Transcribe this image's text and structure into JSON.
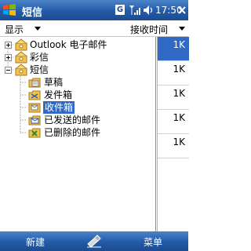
{
  "titlebar": {
    "title": "短信",
    "g_badge": "G",
    "time": "17:50",
    "icons": [
      "windows-start-icon",
      "signal-icon",
      "volume-icon",
      "close-icon"
    ]
  },
  "menubar": {
    "show_label": "显示",
    "sort_label": "接收时间"
  },
  "tree": {
    "items": [
      {
        "label": "Outlook 电子邮件",
        "icon": "account-icon",
        "expander": "plus"
      },
      {
        "label": "彩信",
        "icon": "account-icon",
        "expander": "plus"
      },
      {
        "label": "短信",
        "icon": "account-icon",
        "expander": "minus"
      },
      {
        "label": "草稿",
        "icon": "drafts-icon"
      },
      {
        "label": "发件箱",
        "icon": "outbox-icon"
      },
      {
        "label": "收件箱",
        "icon": "inbox-icon",
        "selected": true
      },
      {
        "label": "已发送的邮件",
        "icon": "sent-icon"
      },
      {
        "label": "已删除的邮件",
        "icon": "deleted-icon"
      }
    ]
  },
  "message_list": {
    "sizes": [
      "1K",
      "1K",
      "1K",
      "1K",
      "1K"
    ]
  },
  "bottombar": {
    "left_label": "新建",
    "right_label": "菜单"
  },
  "colors": {
    "bar_blue": "#235aa6",
    "selection": "#316ac5"
  }
}
